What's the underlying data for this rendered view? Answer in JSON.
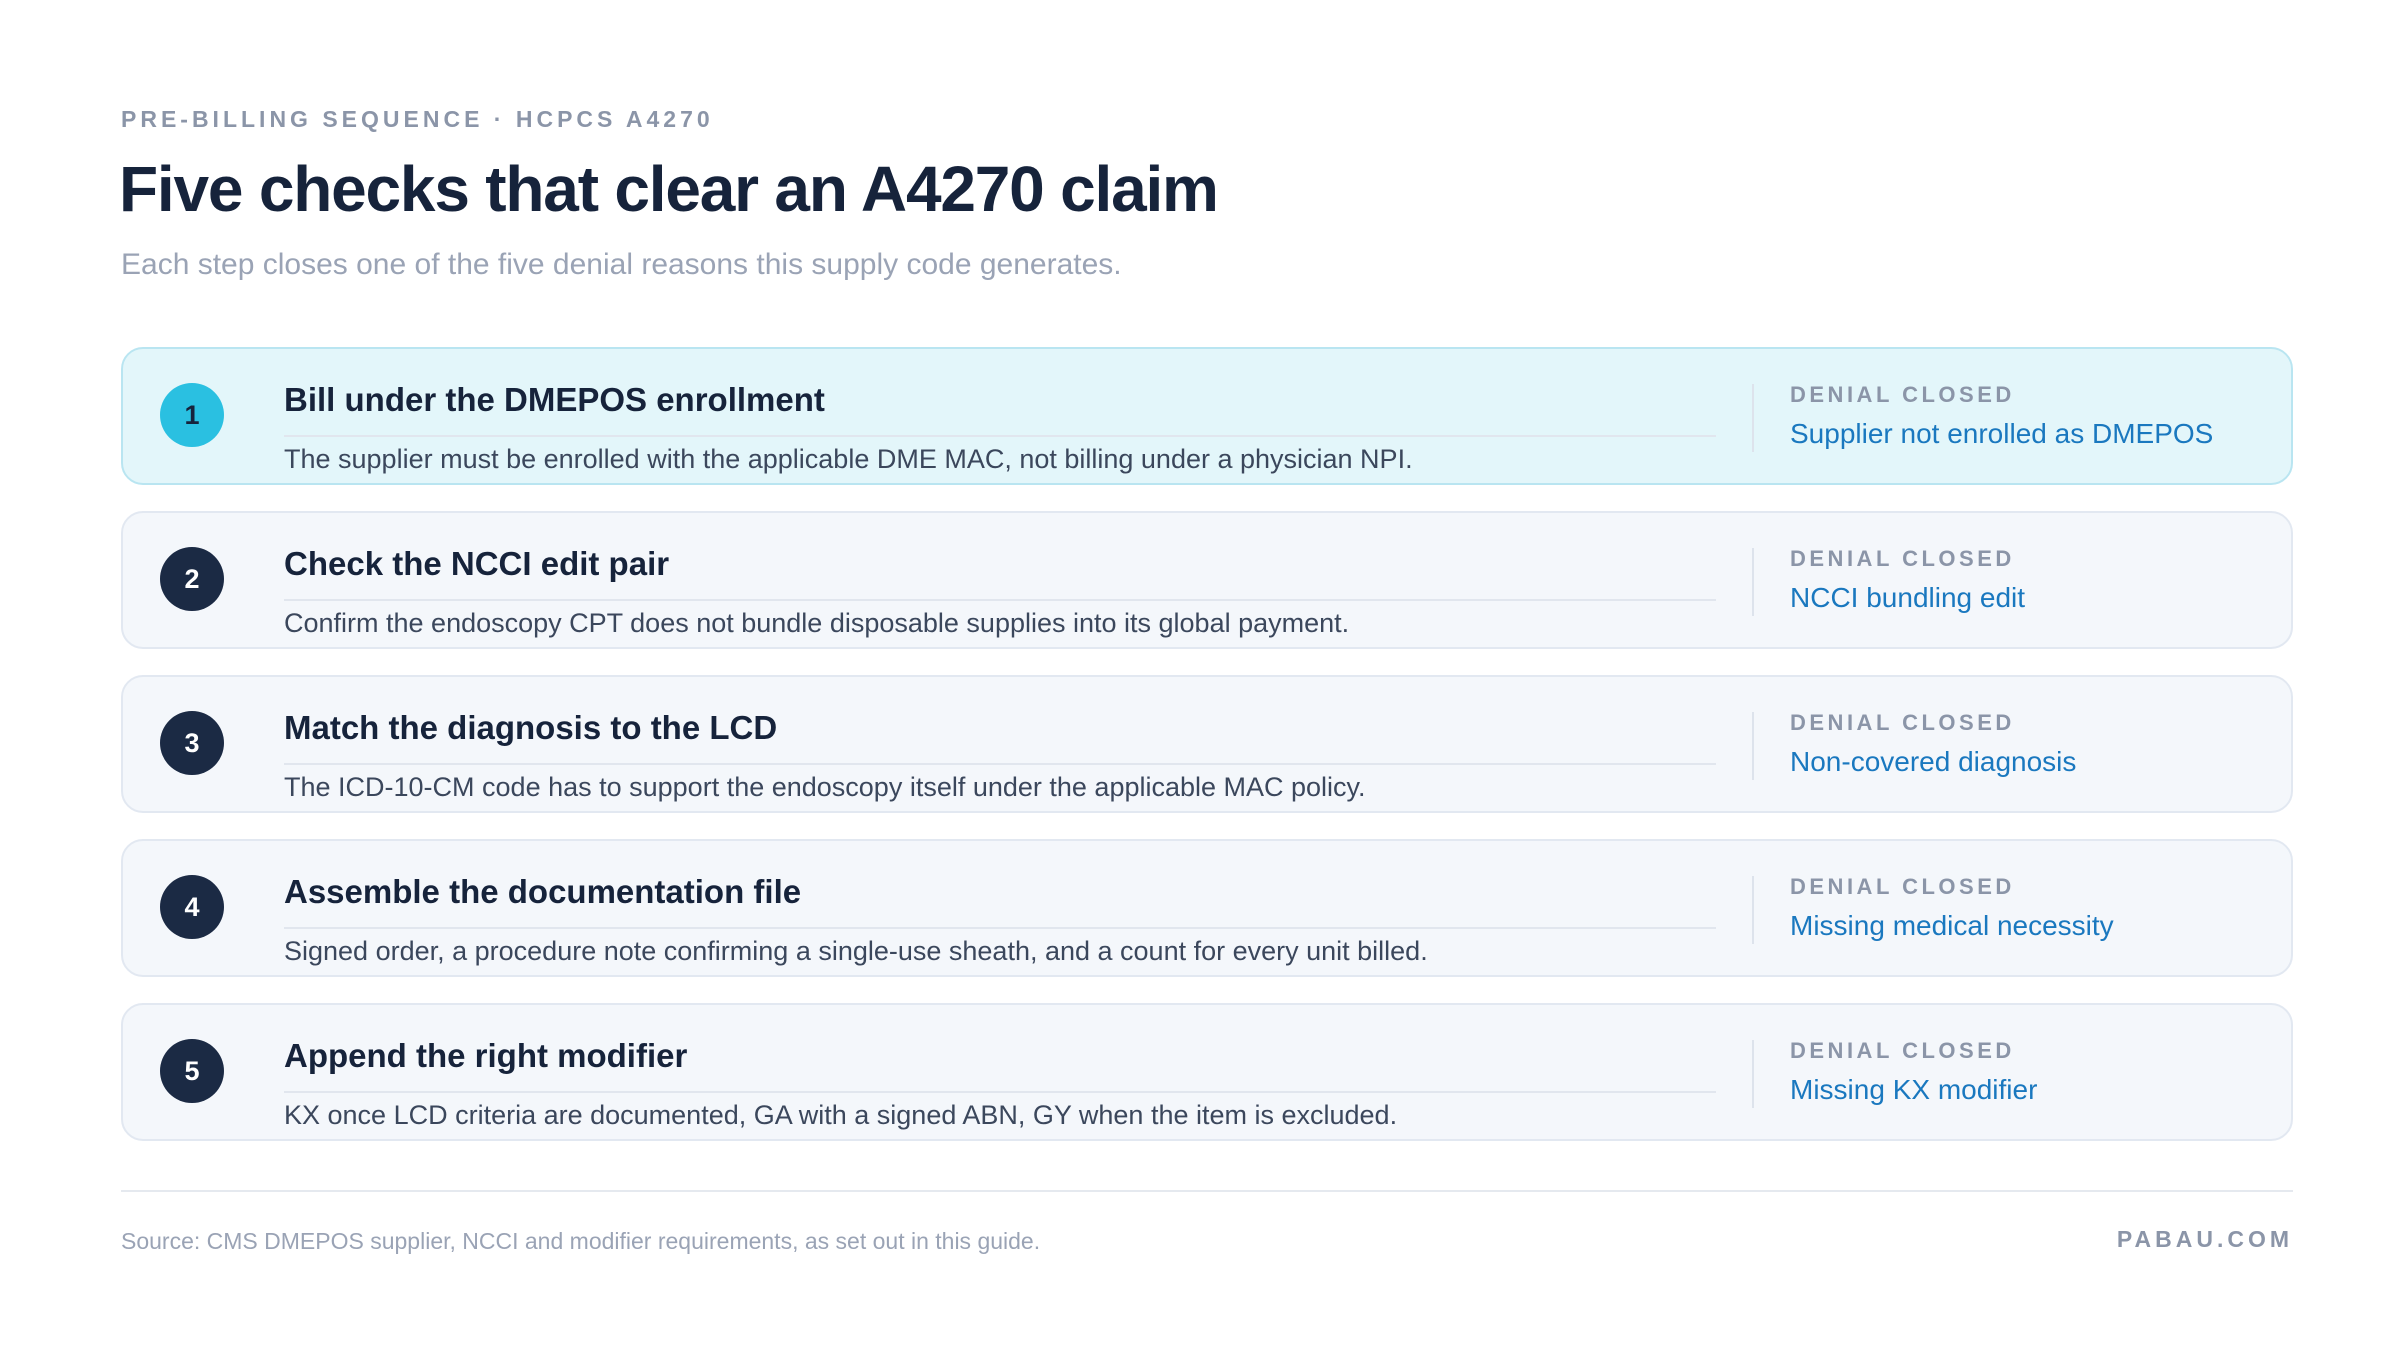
{
  "header": {
    "eyebrow": "PRE-BILLING SEQUENCE · HCPCS A4270",
    "title": "Five checks that clear an A4270 claim",
    "subtitle": "Each step closes one of the five denial reasons this supply code generates."
  },
  "steps": [
    {
      "number": "1",
      "title": "Bill under the DMEPOS enrollment",
      "description": "The supplier must be enrolled with the applicable DME MAC, not billing under a physician NPI.",
      "side_label": "DENIAL CLOSED",
      "side_value": "Supplier not enrolled as DMEPOS"
    },
    {
      "number": "2",
      "title": "Check the NCCI edit pair",
      "description": "Confirm the endoscopy CPT does not bundle disposable supplies into its global payment.",
      "side_label": "DENIAL CLOSED",
      "side_value": "NCCI bundling edit"
    },
    {
      "number": "3",
      "title": "Match the diagnosis to the LCD",
      "description": "The ICD-10-CM code has to support the endoscopy itself under the applicable MAC policy.",
      "side_label": "DENIAL CLOSED",
      "side_value": "Non-covered diagnosis"
    },
    {
      "number": "4",
      "title": "Assemble the documentation file",
      "description": "Signed order, a procedure note confirming a single-use sheath, and a count for every unit billed.",
      "side_label": "DENIAL CLOSED",
      "side_value": "Missing medical necessity"
    },
    {
      "number": "5",
      "title": "Append the right modifier",
      "description": "KX once LCD criteria are documented, GA with a signed ABN, GY when the item is excluded.",
      "side_label": "DENIAL CLOSED",
      "side_value": "Missing KX modifier"
    }
  ],
  "footer": {
    "source": "Source: CMS DMEPOS supplier, NCCI and modifier requirements, as set out in this guide.",
    "brand": "PABAU.COM"
  },
  "colors": {
    "accent": "#2ac0e1",
    "badge": "#1b2a44",
    "link": "#1a78bf",
    "active_card": "#e3f6fa"
  }
}
